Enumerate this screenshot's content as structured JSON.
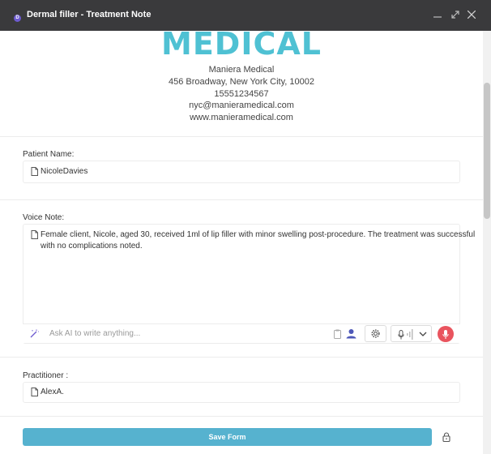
{
  "window": {
    "title": "Dermal filler - Treatment Note",
    "app_icon_letter": "D"
  },
  "clinic": {
    "logo_text": "MEDICAL",
    "name": "Maniera Medical",
    "address": "456 Broadway, New York City, 10002",
    "phone": "15551234567",
    "email": "nyc@manieramedical.com",
    "website": "www.manieramedical.com"
  },
  "form": {
    "patient_label": "Patient Name:",
    "patient_value": "NicoleDavies",
    "voice_label": "Voice Note:",
    "voice_line1": "Female client, Nicole, aged 30, received 1ml of lip filler with minor swelling post-procedure. The treatment was successful",
    "voice_line2": "with no complications noted.",
    "ai_placeholder": "Ask AI to write anything...",
    "practitioner_label": "Practitioner :",
    "practitioner_value": "AlexA.",
    "save_label": "Save Form"
  },
  "colors": {
    "titlebar": "#3a3a3c",
    "accent": "#56b2cf",
    "logo": "#4fc1d3",
    "record": "#e9545e"
  }
}
